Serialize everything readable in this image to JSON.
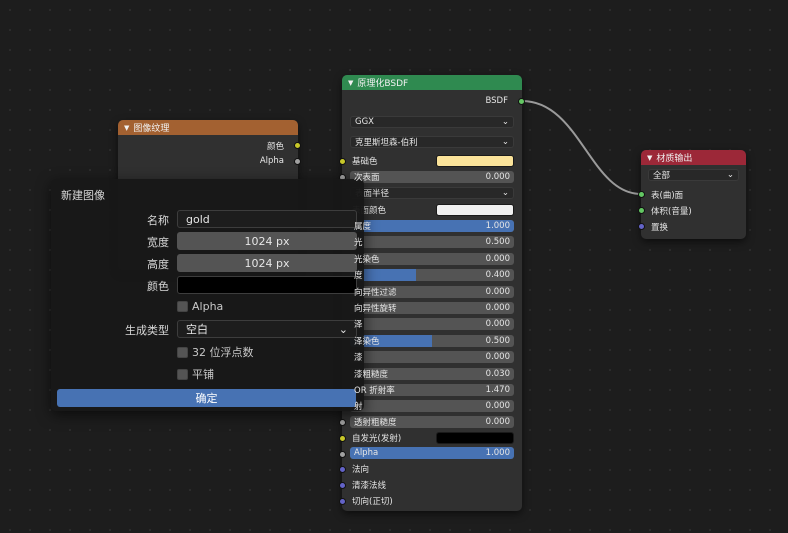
{
  "image_texture": {
    "header": "图像纹理",
    "color_color": "#a36131",
    "outputs": [
      "颜色",
      "Alpha"
    ]
  },
  "bsdf": {
    "header": "原理化BSDF",
    "color_color": "#2f8a50",
    "output": "BSDF",
    "distribution": "GGX",
    "subsurface_method": "克里斯坦森-伯利",
    "base_color_label": "基础色",
    "base_color_swatch": "#fbe39a",
    "subsurface_label": "次表面",
    "subsurface_value": "0.000",
    "subsurface_radius_label": "表面半径",
    "subsurface_color_label": "表面颜色",
    "subsurface_color_swatch": "#f0f0f0",
    "metallic_label": "属度",
    "metallic_value": "1.000",
    "metallic_fraction": 1.0,
    "specular_label": "光",
    "specular_value": "0.500",
    "specular_tint_label": "光染色",
    "specular_tint_value": "0.000",
    "roughness_label": "度",
    "roughness_value": "0.400",
    "roughness_fraction": 0.4,
    "anisotropic_label": "向异性过滤",
    "anisotropic_value": "0.000",
    "anisotropic_rotation_label": "向异性旋转",
    "anisotropic_rotation_value": "0.000",
    "sheen_label": "泽",
    "sheen_value": "0.000",
    "sheen_tint_label": "泽染色",
    "sheen_tint_value": "0.500",
    "sheen_tint_fraction": 0.5,
    "clearcoat_label": "漆",
    "clearcoat_value": "0.000",
    "clearcoat_roughness_label": "漆粗糙度",
    "clearcoat_roughness_value": "0.030",
    "ior_label": "OR 折射率",
    "ior_value": "1.470",
    "transmission_label": "射",
    "transmission_value": "0.000",
    "transmission_roughness_label": "透射粗糙度",
    "transmission_roughness_value": "0.000",
    "emission_label": "自发光(发射)",
    "emission_swatch": "#000000",
    "alpha_label": "Alpha",
    "alpha_value": "1.000",
    "alpha_fraction": 1.0,
    "normal_label": "法向",
    "clearcoat_normal_label": "清漆法线",
    "tangent_label": "切向(正切)"
  },
  "material_output": {
    "header": "材质输出",
    "color_color": "#9c2838",
    "target": "全部",
    "inputs": [
      "表(曲)面",
      "体积(音量)",
      "置换"
    ]
  },
  "new_image_dialog": {
    "title": "新建图像",
    "name_label": "名称",
    "name_value": "gold",
    "width_label": "宽度",
    "width_value": "1024 px",
    "height_label": "高度",
    "height_value": "1024 px",
    "color_label": "颜色",
    "color_swatch": "#000000",
    "alpha_label": "Alpha",
    "generated_type_label": "生成类型",
    "generated_type_value": "空白",
    "float_label": "32 位浮点数",
    "tiled_label": "平铺",
    "ok_label": "确定"
  }
}
